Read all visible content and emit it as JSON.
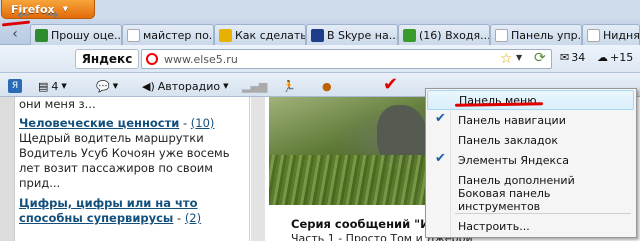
{
  "app": {
    "menu_button": "Firefox"
  },
  "tabs": [
    {
      "label": "Прошу оце...",
      "color": "#2e8b2e"
    },
    {
      "label": "майстер по...",
      "color": "#ffffff"
    },
    {
      "label": "Как сделать...",
      "color": "#e8b000"
    },
    {
      "label": "В Skype на...",
      "color": "#1b3d8a"
    },
    {
      "label": "(16) Входя...",
      "color": "#3a9a2a"
    },
    {
      "label": "Панель упр...",
      "color": "#ffffff"
    },
    {
      "label": "Нидня",
      "color": "#ffffff"
    }
  ],
  "navbar": {
    "search_label": "Яндекс",
    "url": "www.else5.ru",
    "mail_count": "34",
    "weather": "+15"
  },
  "yandex_bar": {
    "bookmarks_count": "4",
    "radio_label": "Автордио",
    "radio_label_full": "Авторадио"
  },
  "content": {
    "left": {
      "intro": "они меня з...",
      "items": [
        {
          "title": "Человеческие ценности",
          "count": "(10)",
          "text": "Щедрый водитель маршрутки Водитель Усуб Кочоян уже восемь лет возит пассажиров по своим прид..."
        },
        {
          "title": "Цифры, цифры или на что способны супервирусы",
          "count": "(2)",
          "text": ""
        }
      ]
    },
    "series_title": "Серия сообщений \"Ист",
    "series_line": "Часть 1 - Просто Том и Джерри"
  },
  "context_menu": {
    "items": [
      {
        "label": "Панель меню",
        "checked": false,
        "highlighted": true
      },
      {
        "label": "Панель навигации",
        "checked": true,
        "highlighted": false
      },
      {
        "label": "Панель закладок",
        "checked": false,
        "highlighted": false
      },
      {
        "label": "Элементы Яндекса",
        "checked": true,
        "highlighted": false
      },
      {
        "label": "Панель дополнений",
        "checked": false,
        "highlighted": false
      },
      {
        "label": "Боковая панель инструментов",
        "checked": false,
        "highlighted": false
      },
      {
        "label": "Настроить...",
        "checked": false,
        "highlighted": false
      }
    ]
  }
}
